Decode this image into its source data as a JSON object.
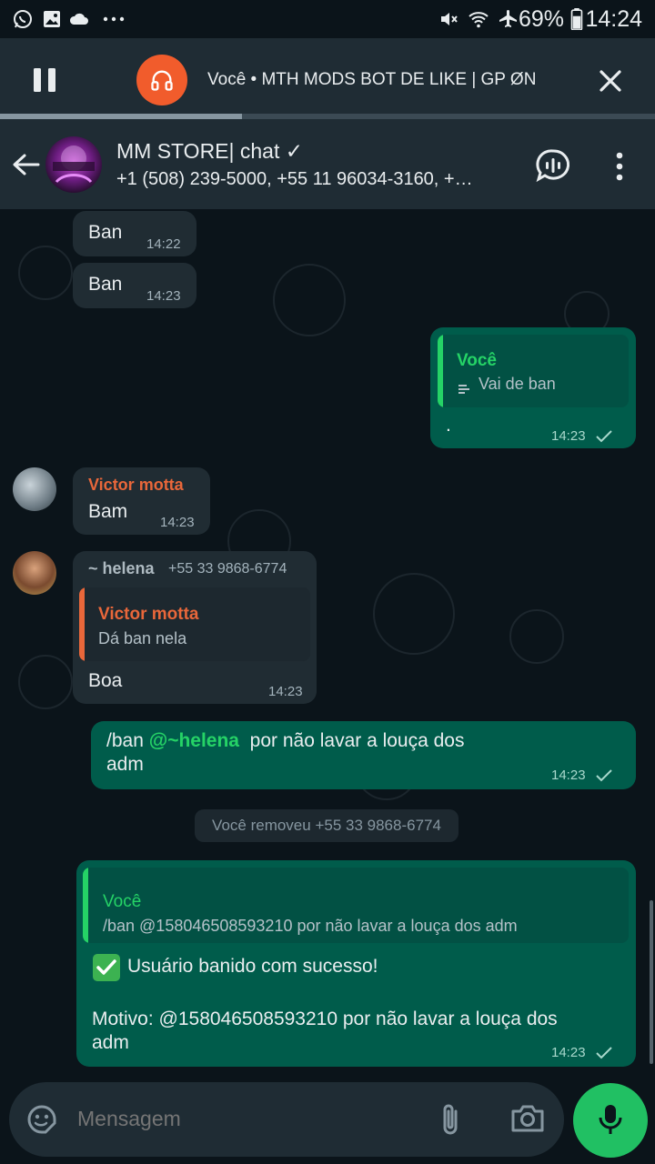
{
  "status_bar": {
    "battery": "69%",
    "time": "14:24",
    "icons": [
      "whatsapp-icon",
      "gallery-icon",
      "cloud-icon",
      "more-dots-icon",
      "mute-icon",
      "wifi-icon",
      "airplane-icon",
      "battery-icon"
    ]
  },
  "audio_player": {
    "title": "Você • MTH MODS BOT DE LIKE | GP ØN",
    "progress": 0.37,
    "icons": [
      "pause-icon",
      "headset-icon",
      "close-icon"
    ]
  },
  "header": {
    "group_name": "MM STORE| chat ✓",
    "members": "+1 (508) 239-5000, +55 11 96034-3160, +…",
    "icons": [
      "back-arrow-icon",
      "voice-chat-icon",
      "kebab-menu-icon"
    ]
  },
  "messages": [
    {
      "dir": "in",
      "text": "Ban",
      "time": "14:22"
    },
    {
      "dir": "in",
      "text": "Ban",
      "time": "14:23"
    },
    {
      "dir": "out",
      "quote_name": "Você",
      "quote_text": "Vai de ban",
      "text": ".",
      "time": "14:23"
    },
    {
      "dir": "in",
      "sender": "Victor motta",
      "text": "Bam",
      "time": "14:23"
    },
    {
      "dir": "in",
      "sender": "~ helena",
      "sender_phone": "+55 33 9868-6774",
      "quote_name": "Victor motta",
      "quote_text": "Dá ban nela",
      "text": "Boa",
      "time": "14:23"
    },
    {
      "dir": "out",
      "text_prefix": "/ban ",
      "mention": "@~helena",
      "text_suffix": "  por não lavar a louça dos",
      "text_line2": "adm",
      "time": "14:23"
    },
    {
      "dir": "out",
      "quote_name": "Você",
      "quote_text": "/ban @158046508593210  por não lavar a louça dos adm",
      "line1": "Usuário banido com sucesso!",
      "line2": "Motivo: @158046508593210 por não lavar a louça dos",
      "line3": "adm",
      "time": "14:23"
    }
  ],
  "system_notice": "Você removeu +55 33 9868-6774",
  "composer": {
    "placeholder": "Mensagem",
    "icons": [
      "sticker-icon",
      "attach-icon",
      "camera-icon",
      "mic-icon"
    ]
  },
  "colors": {
    "accent_green": "#21c063",
    "outgoing_bubble": "#005c4b",
    "incoming_bubble": "#202c33",
    "sender_orange": "#e9673a",
    "headset_orange": "#f15c2c",
    "mention_green": "#25d366"
  }
}
